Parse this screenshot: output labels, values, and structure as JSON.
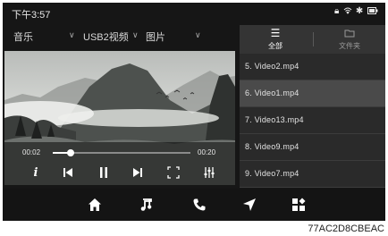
{
  "status_bar": {
    "time": "下午3:57",
    "icons": [
      "lock-icon",
      "wifi-icon",
      "bluetooth-icon",
      "battery-icon"
    ]
  },
  "sources": {
    "music": "音乐",
    "usb": "USB2视频",
    "pictures": "图片"
  },
  "player": {
    "elapsed": "00:02",
    "duration": "00:20",
    "progress": 0.13
  },
  "controls": [
    "info-icon",
    "previous-icon",
    "pause-icon",
    "next-icon",
    "fullscreen-icon",
    "equalizer-icon"
  ],
  "playlist": {
    "tabs": [
      {
        "label": "全部",
        "active": true
      },
      {
        "label": "文件夹",
        "active": false
      }
    ],
    "items": [
      "5. Video2.mp4",
      "6. Video1.mp4",
      "7. Video13.mp4",
      "8. Video9.mp4",
      "9. Video7.mp4"
    ],
    "selected_index": 1
  },
  "nav": [
    "home-icon",
    "music-icon",
    "phone-icon",
    "navigation-icon",
    "apps-icon"
  ],
  "figure_code": "77AC2D8CBEAC",
  "colors": {
    "screen_bg": "#161616",
    "list_row": "#2a2a2a",
    "list_selected": "#4a4a4a",
    "tab_bar": "#343434"
  }
}
